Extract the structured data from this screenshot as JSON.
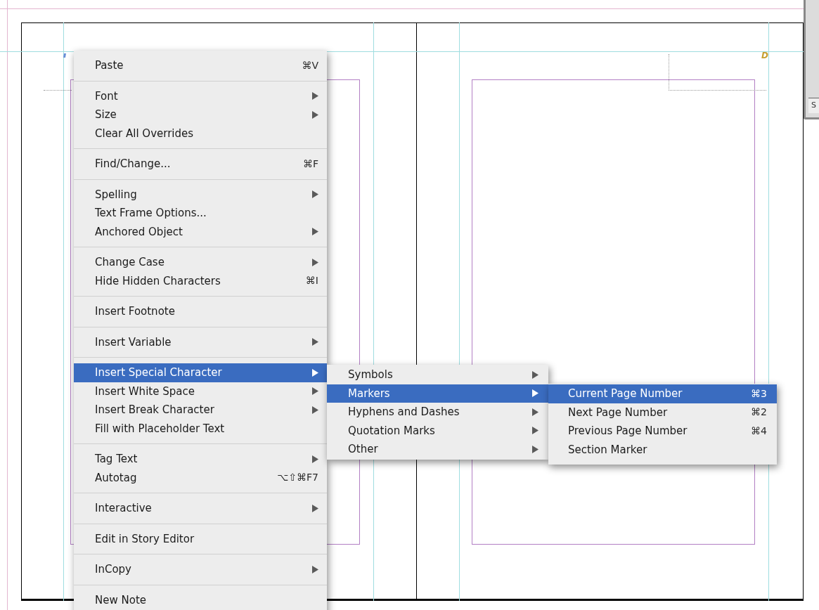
{
  "canvas": {
    "page_marker": "D",
    "panel_tab": "S"
  },
  "context_menu": {
    "groups": [
      [
        {
          "label": "Paste",
          "shortcut": "⌘V",
          "has_submenu": false,
          "selected": false
        }
      ],
      [
        {
          "label": "Font",
          "has_submenu": true,
          "selected": false
        },
        {
          "label": "Size",
          "has_submenu": true,
          "selected": false
        },
        {
          "label": "Clear All Overrides",
          "has_submenu": false,
          "selected": false
        }
      ],
      [
        {
          "label": "Find/Change...",
          "shortcut": "⌘F",
          "has_submenu": false,
          "selected": false
        }
      ],
      [
        {
          "label": "Spelling",
          "has_submenu": true,
          "selected": false
        },
        {
          "label": "Text Frame Options...",
          "has_submenu": false,
          "selected": false
        },
        {
          "label": "Anchored Object",
          "has_submenu": true,
          "selected": false
        }
      ],
      [
        {
          "label": "Change Case",
          "has_submenu": true,
          "selected": false
        },
        {
          "label": "Hide Hidden Characters",
          "shortcut": "⌘I",
          "has_submenu": false,
          "selected": false
        }
      ],
      [
        {
          "label": "Insert Footnote",
          "has_submenu": false,
          "selected": false
        }
      ],
      [
        {
          "label": "Insert Variable",
          "has_submenu": true,
          "selected": false
        }
      ],
      [
        {
          "label": "Insert Special Character",
          "has_submenu": true,
          "selected": true
        },
        {
          "label": "Insert White Space",
          "has_submenu": true,
          "selected": false
        },
        {
          "label": "Insert Break Character",
          "has_submenu": true,
          "selected": false
        },
        {
          "label": "Fill with Placeholder Text",
          "has_submenu": false,
          "selected": false
        }
      ],
      [
        {
          "label": "Tag Text",
          "has_submenu": true,
          "selected": false
        },
        {
          "label": "Autotag",
          "shortcut": "⌥⇧⌘F7",
          "has_submenu": false,
          "selected": false
        }
      ],
      [
        {
          "label": "Interactive",
          "has_submenu": true,
          "selected": false
        }
      ],
      [
        {
          "label": "Edit in Story Editor",
          "has_submenu": false,
          "selected": false
        }
      ],
      [
        {
          "label": "InCopy",
          "has_submenu": true,
          "selected": false
        }
      ],
      [
        {
          "label": "New Note",
          "has_submenu": false,
          "selected": false
        }
      ]
    ]
  },
  "submenus": [
    {
      "items": [
        {
          "label": "Symbols",
          "has_submenu": true,
          "selected": false
        },
        {
          "label": "Markers",
          "has_submenu": true,
          "selected": true
        },
        {
          "label": "Hyphens and Dashes",
          "has_submenu": true,
          "selected": false
        },
        {
          "label": "Quotation Marks",
          "has_submenu": true,
          "selected": false
        },
        {
          "label": "Other",
          "has_submenu": true,
          "selected": false
        }
      ]
    },
    {
      "items": [
        {
          "label": "Current Page Number",
          "shortcut": "⌘3",
          "has_submenu": false,
          "selected": true
        },
        {
          "label": "Next Page Number",
          "shortcut": "⌘2",
          "has_submenu": false,
          "selected": false
        },
        {
          "label": "Previous Page Number",
          "shortcut": "⌘4",
          "has_submenu": false,
          "selected": false
        },
        {
          "label": "Section Marker",
          "has_submenu": false,
          "selected": false
        }
      ]
    }
  ]
}
